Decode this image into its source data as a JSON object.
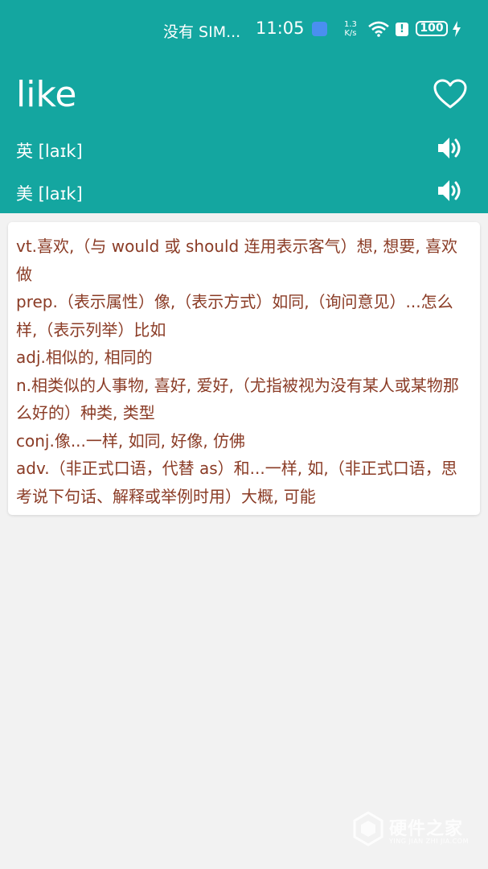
{
  "status_bar": {
    "carrier": "没有 SIM...",
    "time": "11:05",
    "speed_value": "1.3",
    "speed_unit": "K/s",
    "battery": "100"
  },
  "entry": {
    "word": "like",
    "uk_pron": "英 [laɪk]",
    "us_pron": "美 [laɪk]"
  },
  "definitions": [
    "vt.喜欢,（与 would 或 should 连用表示客气）想, 想要, 喜欢做",
    "prep.（表示属性）像,（表示方式）如同,（询问意见）...怎么样,（表示列举）比如",
    "adj.相似的, 相同的",
    "n.相类似的人事物, 喜好, 爱好,（尤指被视为没有某人或某物那么好的）种类, 类型",
    "conj.像...一样, 如同, 好像, 仿佛",
    "adv.（非正式口语，代替 as）和...一样, 如,（非正式口语，思考说下句话、解释或举例时用）大概, 可能"
  ],
  "watermark": {
    "main": "硬件之家",
    "sub": "YING JIAN ZHI JIA.COM"
  },
  "colors": {
    "header": "#14a6a0",
    "definition_text": "#8a3b25",
    "background": "#f2f2f2"
  }
}
